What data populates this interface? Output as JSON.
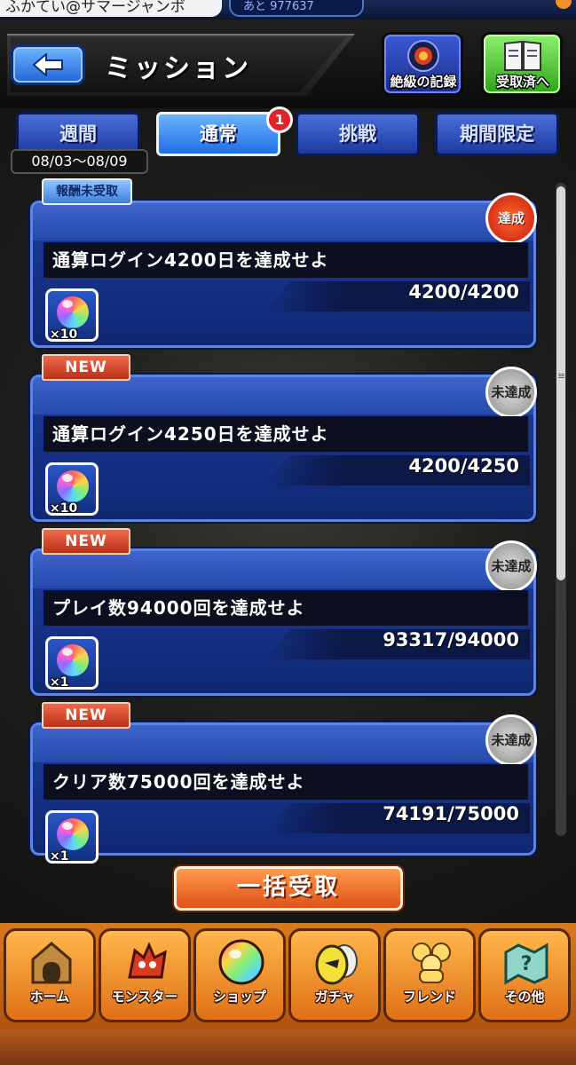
{
  "status_bar": {
    "username": "ふかてい@サマージャンボ",
    "remaining": "あと 977637"
  },
  "header": {
    "title": "ミッション",
    "record_button_label": "絶級の記録",
    "received_button_label": "受取済へ"
  },
  "tabs": [
    {
      "label": "週間",
      "active": false
    },
    {
      "label": "通常",
      "active": true,
      "badge": "1"
    },
    {
      "label": "挑戦",
      "active": false
    },
    {
      "label": "期間限定",
      "active": false
    }
  ],
  "date_range": "08/03〜08/09",
  "missions": [
    {
      "tag": "報酬未受取",
      "title": "通算ログイン4200日を達成せよ",
      "progress": "4200/4200",
      "reward_count": "×10",
      "status": "達成"
    },
    {
      "tag": "NEW",
      "title": "通算ログイン4250日を達成せよ",
      "progress": "4200/4250",
      "reward_count": "×10",
      "status": "未達成"
    },
    {
      "tag": "NEW",
      "title": "プレイ数94000回を達成せよ",
      "progress": "93317/94000",
      "reward_count": "×1",
      "status": "未達成"
    },
    {
      "tag": "NEW",
      "title": "クリア数75000回を達成せよ",
      "progress": "74191/75000",
      "reward_count": "×1",
      "status": "未達成"
    }
  ],
  "claim_all_button": "一括受取",
  "bottom_nav": [
    {
      "label": "ホーム",
      "icon": "home-icon"
    },
    {
      "label": "モンスター",
      "icon": "monster-icon"
    },
    {
      "label": "ショップ",
      "icon": "orb-icon"
    },
    {
      "label": "ガチャ",
      "icon": "egg-icon"
    },
    {
      "label": "フレンド",
      "icon": "friends-icon"
    },
    {
      "label": "その他",
      "icon": "map-icon"
    }
  ],
  "colors": {
    "accent_orange": "#e0501a",
    "tab_blue": "#1f6ee6",
    "card_blue": "#1e3c9c",
    "badge_red": "#e0242a"
  }
}
